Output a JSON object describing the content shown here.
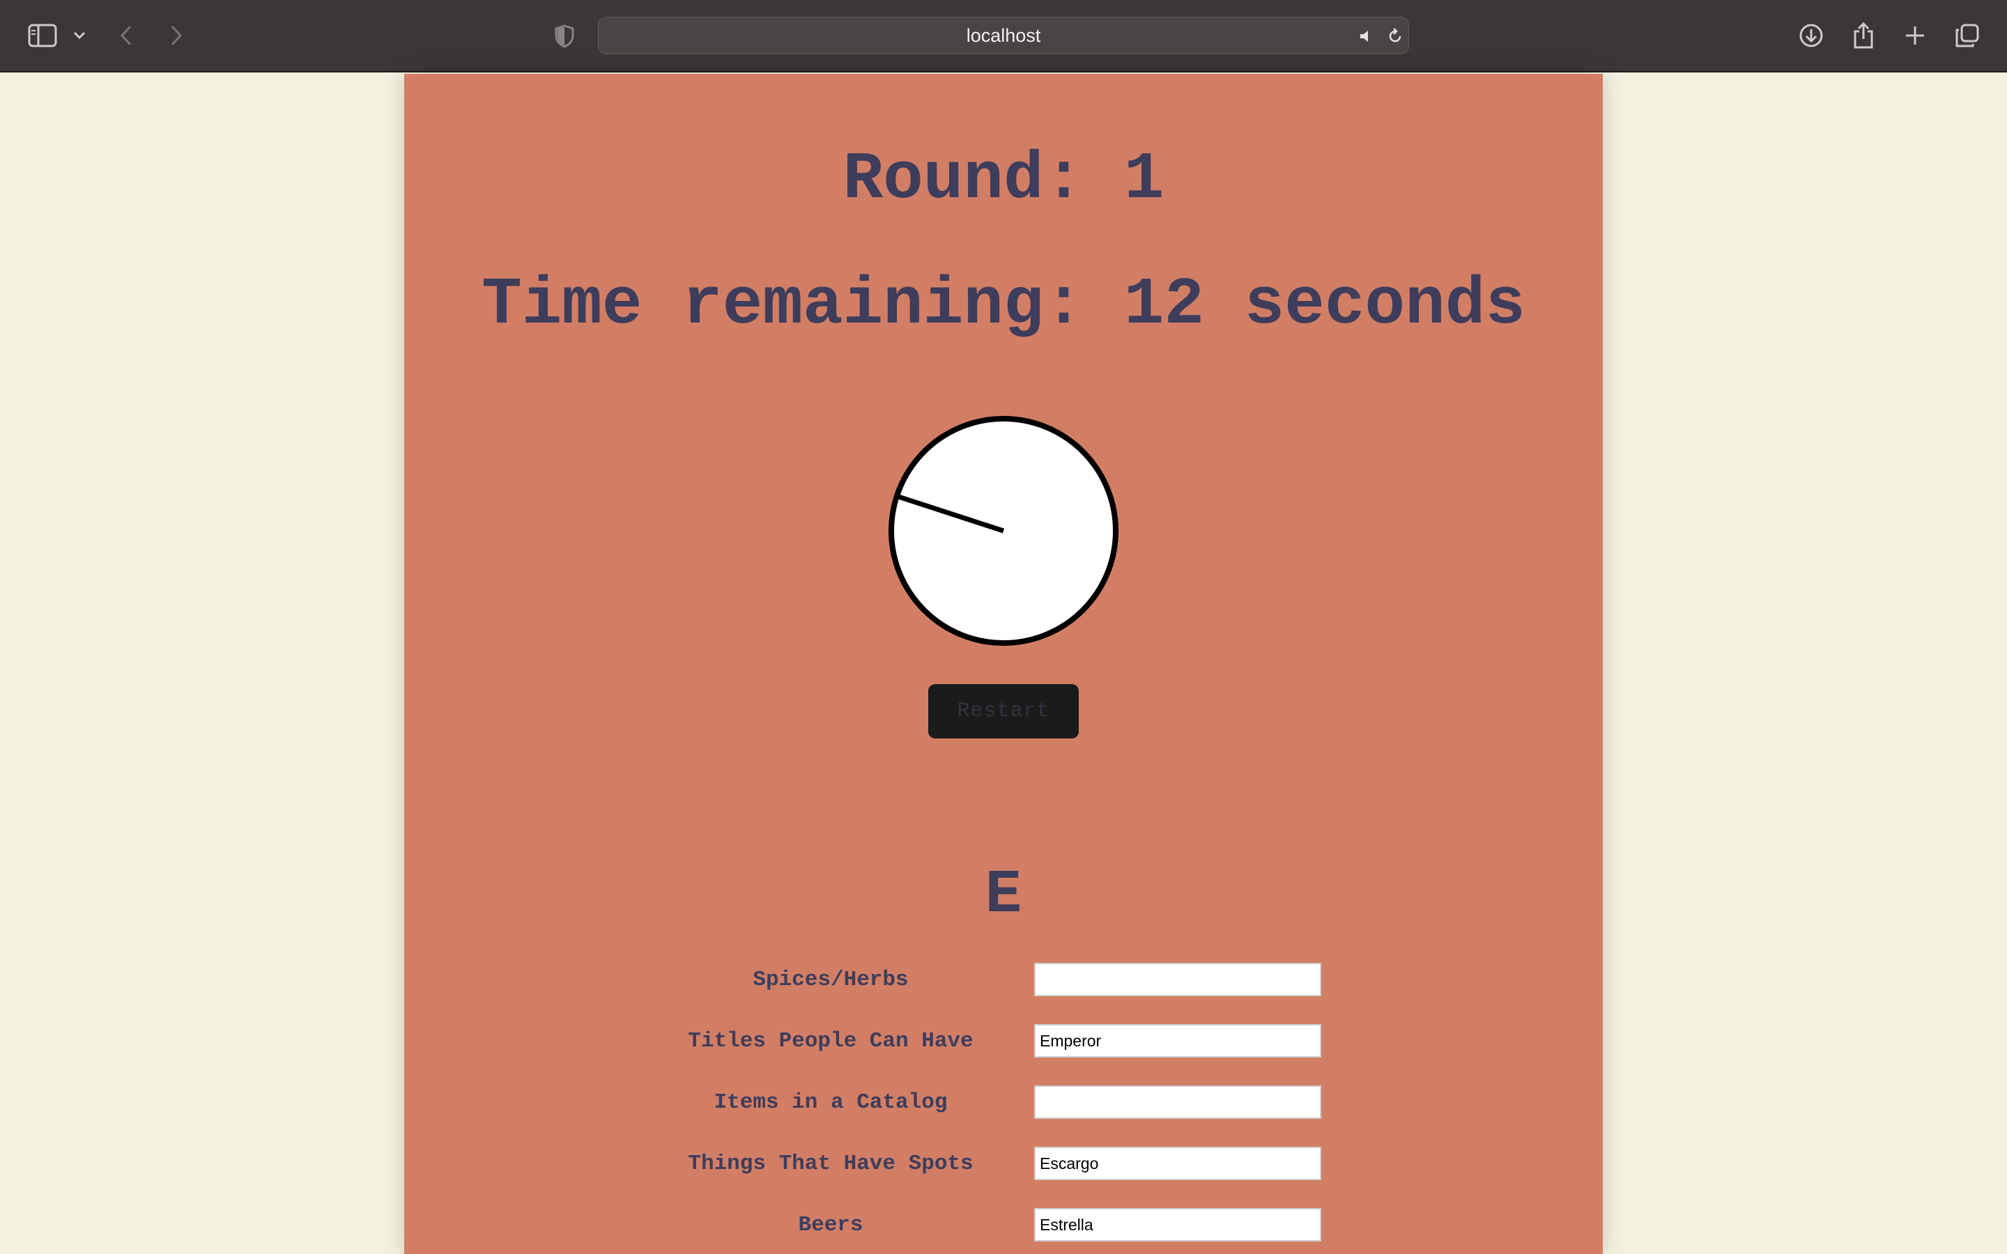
{
  "browser": {
    "address": "localhost",
    "icons": {
      "sidebar": "sidebar-icon",
      "chevron": "chevron-down-icon",
      "back": "back-arrow-icon",
      "forward": "forward-arrow-icon",
      "privacy": "shield-icon",
      "audio": "speaker-icon",
      "reload": "reload-icon",
      "download": "download-icon",
      "share": "share-icon",
      "new_tab": "plus-icon",
      "tabs": "tab-overview-icon"
    }
  },
  "game": {
    "round_text": "Round: 1",
    "time_text": "Time remaining: 12 seconds",
    "restart_label": "Restart",
    "letter": "E",
    "clock_fraction_remaining": 0.2,
    "categories": [
      {
        "label": "Spices/Herbs",
        "value": ""
      },
      {
        "label": "Titles People Can Have",
        "value": "Emperor"
      },
      {
        "label": "Items in a Catalog",
        "value": ""
      },
      {
        "label": "Things That Have Spots",
        "value": "Escargo"
      },
      {
        "label": "Beers",
        "value": "Estrella"
      }
    ]
  },
  "colors": {
    "page_background": "#f2f1df",
    "panel": "#d27e65",
    "text": "#3e3d5c",
    "button": "#1b1b1b",
    "toolbar": "#3b3736"
  }
}
